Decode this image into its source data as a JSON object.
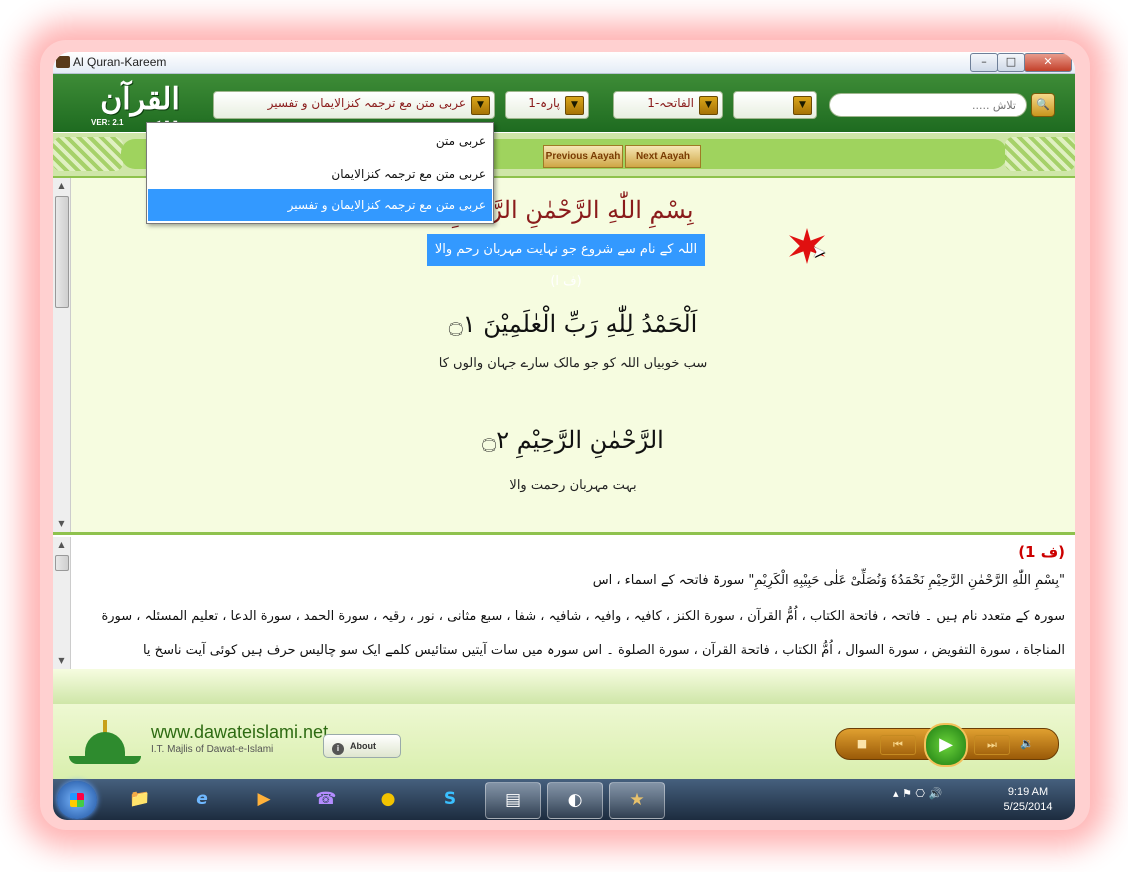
{
  "window": {
    "title": "Al Quran-Kareem",
    "min_glyph": "–",
    "max_glyph": "□",
    "close_glyph": "✕"
  },
  "logo": {
    "text": "القرآن الكريم",
    "version": "VER: 2.1"
  },
  "toolbar": {
    "translation_value": "عربی متن مع ترجمہ کنزالایمان و تفسیر",
    "para_value": "پارہ-1",
    "surah_value": "الفاتحہ-1",
    "aayah_value": "",
    "search_placeholder": "تلاش .....",
    "search_glyph": "🔍",
    "arrow_glyph": "▼"
  },
  "dropdown": {
    "items": [
      {
        "label": "عربی متن"
      },
      {
        "label": "عربی متن مع ترجمہ کنزالایمان"
      },
      {
        "label": "عربی متن مع ترجمہ کنزالایمان و تفسیر"
      }
    ]
  },
  "nav": {
    "prev_label": "Previous Aayah",
    "next_label": "Next Aayah"
  },
  "content": {
    "bismillah": "بِسْمِ اللّٰهِ الرَّحْمٰنِ الرَّحِیْمِ",
    "bismillah_translation": "اللہ کے نام سے شروع جو نہایت مہربان رحم والا (ف ا)",
    "ayah1": "اَلْحَمْدُ لِلّٰهِ رَبِّ الْعٰلَمِیْنَ ۝١",
    "ayah1_translation": "سب خوبیاں اللہ کو جو مالک سارے جہان والوں کا",
    "ayah2": "الرَّحْمٰنِ الرَّحِیْمِ ۝٢",
    "ayah2_translation": "بہت مہربان رحمت والا"
  },
  "tafseer": {
    "ref": "(ف 1)",
    "lines": [
      "\"بِسْمِ اللّٰهِ الرَّحْمٰنِ الرَّحِیْمِ نَحْمَدُهٗ وَنُصَلِّیْ عَلٰی حَبِیْبِهِ الْکَرِیْمِ\" سورۃ فاتحہ کے اسماء ، اس",
      "سورہ کے متعدد نام ہیں ۔ فاتحہ ، فاتحة الکتاب ، اُمُّ القرآن ، سورة الکنز ، کافیہ ، وافیہ ، شافیہ ، شفا ، سبع مثانی ، نور ، رقیہ ، سورة الحمد ، سورة الدعا ، تعلیم المسئلہ ، سورة",
      "المناجاة ، سورة التفویض ، سورة السوال ، اُمُّ الکتاب ، فاتحة القرآن ، سورة الصلوة ۔ اس سورہ میں سات آیتیں ستائیس کلمے ایک سو چالیس حرف ہیں کوئی آیت ناسخ یا"
    ]
  },
  "footer": {
    "site": "www.dawateislami.net",
    "subtitle": "I.T. Majlis of Dawat-e-Islami",
    "about_label": "About",
    "about_icon_glyph": "i"
  },
  "player": {
    "stop_glyph": "■",
    "prev_glyph": "⏮",
    "play_glyph": "▶",
    "next_glyph": "⏭",
    "volume_glyph": "🔉"
  },
  "taskbar": {
    "items": [
      {
        "glyph": "📁"
      },
      {
        "glyph": "e"
      },
      {
        "glyph": "▶"
      },
      {
        "glyph": "☎"
      },
      {
        "glyph": "●"
      },
      {
        "glyph": "S"
      },
      {
        "glyph": "▤"
      },
      {
        "glyph": "◐"
      },
      {
        "glyph": "★"
      }
    ],
    "tray_glyphs": "▴  ⚑  ⎔  🔊",
    "clock_time": "9:19 AM",
    "clock_date": "5/25/2014"
  }
}
